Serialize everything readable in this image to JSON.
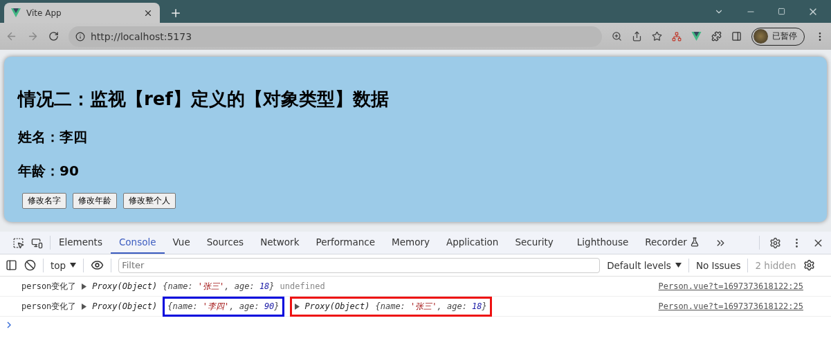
{
  "browser": {
    "tab_title": "Vite App",
    "url": "http://localhost:5173",
    "profile": "已暂停"
  },
  "page": {
    "title": "情况二：监视【ref】定义的【对象类型】数据",
    "name_line": "姓名：李四",
    "age_line": "年龄：90",
    "buttons": [
      "修改名字",
      "修改年龄",
      "修改整个人"
    ]
  },
  "devtools": {
    "tabs": [
      {
        "label": "Elements",
        "selected": false
      },
      {
        "label": "Console",
        "selected": true
      },
      {
        "label": "Vue",
        "selected": false
      },
      {
        "label": "Sources",
        "selected": false
      },
      {
        "label": "Network",
        "selected": false
      },
      {
        "label": "Performance",
        "selected": false
      },
      {
        "label": "Memory",
        "selected": false
      },
      {
        "label": "Application",
        "selected": false
      },
      {
        "label": "Security",
        "selected": false
      },
      {
        "label": "Lighthouse",
        "selected": false
      },
      {
        "label": "Recorder",
        "selected": false
      }
    ],
    "context": "top",
    "filter_placeholder": "Filter",
    "levels": "Default levels",
    "issues": "No Issues",
    "hidden": "2 hidden"
  },
  "console": [
    {
      "label": "person变化了",
      "source": "Person.vue?t=1697373618122:25",
      "args": [
        {
          "kind": "proxy",
          "expandable": true,
          "prefix": "Proxy(Object)",
          "preview": [
            {
              "text": "{name: ",
              "kind": "key"
            },
            {
              "text": "'张三'",
              "kind": "string"
            },
            {
              "text": ", age: ",
              "kind": "key"
            },
            {
              "text": "18",
              "kind": "number"
            },
            {
              "text": "}",
              "kind": "key"
            }
          ]
        },
        {
          "kind": "plain",
          "text": "undefined"
        }
      ]
    },
    {
      "label": "person变化了",
      "source": "Person.vue?t=1697373618122:25",
      "args": [
        {
          "kind": "proxy_object_framed",
          "expandable": true,
          "prefix": "Proxy(Object)",
          "color": "#0000dd",
          "preview": [
            {
              "text": "{name: ",
              "kind": "key"
            },
            {
              "text": "'李四'",
              "kind": "string"
            },
            {
              "text": ", age: ",
              "kind": "key"
            },
            {
              "text": "90",
              "kind": "number"
            },
            {
              "text": "}",
              "kind": "key"
            }
          ]
        },
        {
          "kind": "proxy_framed",
          "expandable": true,
          "prefix": "Proxy(Object)",
          "color": "#ee1111",
          "preview": [
            {
              "text": "{name: ",
              "kind": "key"
            },
            {
              "text": "'张三'",
              "kind": "string"
            },
            {
              "text": ", age: ",
              "kind": "key"
            },
            {
              "text": "18",
              "kind": "number"
            },
            {
              "text": "}",
              "kind": "key"
            }
          ]
        }
      ]
    }
  ]
}
